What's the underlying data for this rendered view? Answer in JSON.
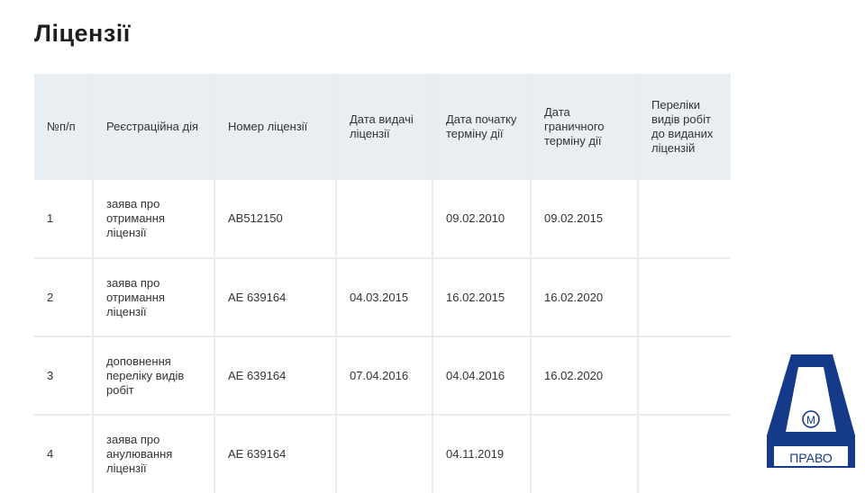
{
  "page": {
    "title": "Ліцензії"
  },
  "table": {
    "columns": [
      "№п/п",
      "Реєстраційна дія",
      "Номер ліцензії",
      "Дата видачі ліцензії",
      "Дата початку терміну дії",
      "Дата граничного терміну дії",
      "Переліки видів робіт до виданих ліцензій"
    ],
    "rows": [
      {
        "num": "1",
        "action": "заява про отримання ліцензії",
        "license": "АВ512150",
        "issue": "",
        "start": "09.02.2010",
        "end": "09.02.2015",
        "lists": ""
      },
      {
        "num": "2",
        "action": "заява про отримання ліцензії",
        "license": "АЕ 639164",
        "issue": "04.03.2015",
        "start": "16.02.2015",
        "end": "16.02.2020",
        "lists": ""
      },
      {
        "num": "3",
        "action": "доповнення переліку видів робіт",
        "license": "АЕ 639164",
        "issue": "07.04.2016",
        "start": "04.04.2016",
        "end": "16.02.2020",
        "lists": ""
      },
      {
        "num": "4",
        "action": "заява про анулювання ліцензії",
        "license": "АЕ 639164",
        "issue": "",
        "start": "04.11.2019",
        "end": "",
        "lists": ""
      }
    ]
  },
  "logo": {
    "text": "ПРАВО",
    "mark": "М",
    "color": "#163a8a"
  }
}
